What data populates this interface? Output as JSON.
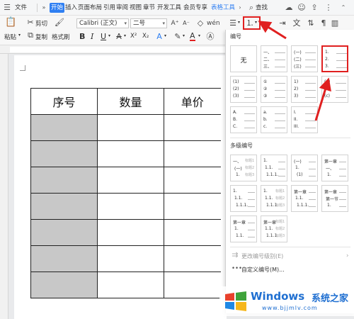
{
  "menubar": {
    "items": [
      "文件",
      "开始",
      "插入",
      "页面布局",
      "引用",
      "审阅",
      "视图",
      "章节",
      "开发工具",
      "会员专享",
      "表格工具"
    ],
    "active_index": 1,
    "accent_index": 10,
    "search_label": "查找"
  },
  "ribbon": {
    "paste_label": "粘贴",
    "cut_label": "剪切",
    "copy_label": "复制",
    "format_painter_label": "格式刷",
    "font_name": "Calibri (正文)",
    "font_size": "二号",
    "bold": "B",
    "italic": "I",
    "underline": "U",
    "font_color_glyph": "A",
    "x2": "X²",
    "x_sub": "X₂"
  },
  "document": {
    "table": {
      "headers": [
        "序号",
        "数量",
        "单价"
      ],
      "body_rows": 7
    }
  },
  "panel": {
    "section_numbering": "编号",
    "section_multilevel": "多级编号",
    "none_label": "无",
    "single_styles": [
      [
        "无"
      ],
      [
        "一、",
        "二、",
        "三、"
      ],
      [
        "(一)",
        "(二)",
        "(三)"
      ],
      [
        "1.",
        "2.",
        "3."
      ],
      [
        "(1)",
        "(2)",
        "(3)"
      ],
      [
        "①",
        "②",
        "③"
      ],
      [
        "1)",
        "2)",
        "3)"
      ],
      [
        "(a)",
        "(b)",
        "(c)"
      ],
      [
        "A.",
        "B.",
        "C."
      ],
      [
        "a.",
        "b.",
        "c."
      ],
      [
        "I.",
        "II.",
        "III."
      ]
    ],
    "multi_styles": [
      [
        [
          "一、",
          "标题1"
        ],
        [
          "(一)",
          "标题2"
        ],
        [
          "1.",
          "标题3"
        ]
      ],
      [
        [
          "1.",
          ""
        ],
        [
          "1.1.",
          ""
        ],
        [
          "1.1.1.",
          ""
        ]
      ],
      [
        [
          "(一)",
          ""
        ],
        [
          "1.",
          ""
        ],
        [
          "(1)",
          ""
        ]
      ],
      [
        [
          "第一章",
          ""
        ],
        [
          "一、",
          ""
        ],
        [
          "1.",
          ""
        ]
      ],
      [
        [
          "1.",
          ""
        ],
        [
          "1.1.",
          ""
        ],
        [
          "1.1.1.",
          ""
        ]
      ],
      [
        [
          "1.",
          "标题1"
        ],
        [
          "1.1.",
          "标题2"
        ],
        [
          "1.1.1.",
          "标题3"
        ]
      ],
      [
        [
          "第一章",
          ""
        ],
        [
          "1.1.",
          ""
        ],
        [
          "1.1.1.",
          ""
        ]
      ],
      [
        [
          "第一章",
          ""
        ],
        [
          "第一节",
          ""
        ],
        [
          "1.",
          ""
        ]
      ],
      [
        [
          "第一章",
          ""
        ],
        [
          "1.",
          ""
        ],
        [
          "1.1.",
          ""
        ]
      ],
      [
        [
          "第一章",
          "标题1"
        ],
        [
          "1.1.",
          "标题2"
        ],
        [
          "1.1.1.",
          "标题3"
        ]
      ]
    ],
    "change_level_label": "更改编号级别(E)",
    "custom_numbering_label": "自定义编号(M)..."
  },
  "watermark": {
    "brand": "Windows",
    "brand_cn": "系统之家",
    "url": "www.bjjmlv.com"
  },
  "colors": {
    "accent_blue": "#2f7ff2",
    "highlight_red": "#e02020",
    "cell_gray": "#c8c8c8"
  }
}
